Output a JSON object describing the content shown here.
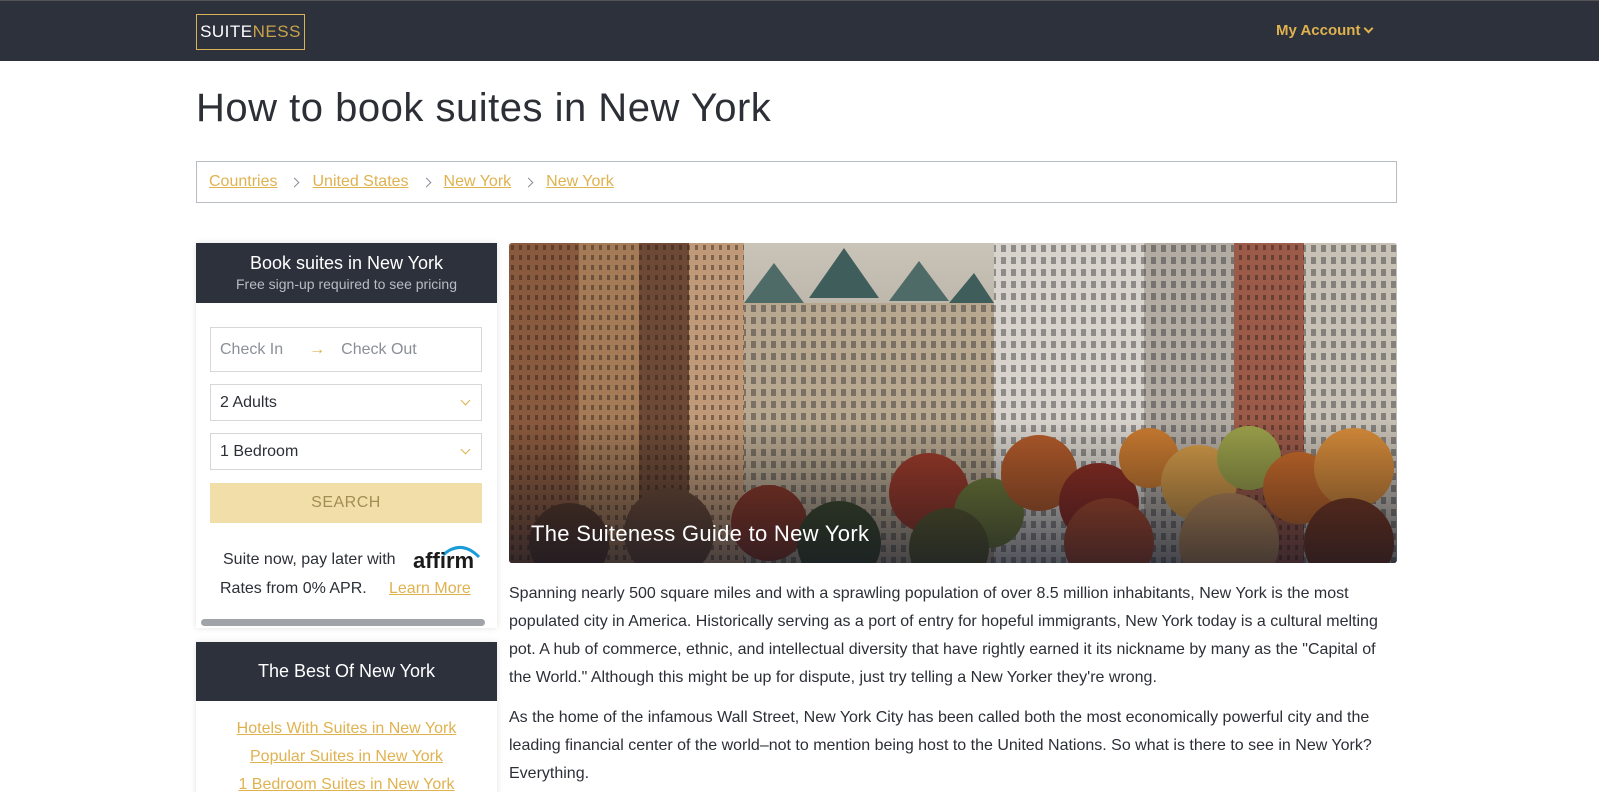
{
  "header": {
    "logo_part1": "SUITE",
    "logo_part2": "NESS",
    "account_label": "My Account"
  },
  "page": {
    "title": "How to book suites in New York"
  },
  "breadcrumb": [
    {
      "label": "Countries"
    },
    {
      "label": "United States"
    },
    {
      "label": "New York"
    },
    {
      "label": "New York"
    }
  ],
  "booking": {
    "heading": "Book suites in New York",
    "subheading": "Free sign-up required to see pricing",
    "check_in_placeholder": "Check In",
    "check_out_placeholder": "Check Out",
    "adults_value": "2 Adults",
    "bedroom_value": "1 Bedroom",
    "search_label": "SEARCH",
    "affirm_line1": "Suite now, pay later with",
    "affirm_logo": "affirm",
    "affirm_line2": "Rates from 0% APR.",
    "learn_more": "Learn More"
  },
  "best_of": {
    "heading": "The Best Of New York",
    "links": [
      "Hotels With Suites in New York",
      "Popular Suites in New York",
      "1 Bedroom Suites in New York"
    ]
  },
  "hero": {
    "caption": "The Suiteness Guide to New York"
  },
  "article": {
    "paragraph1": "Spanning nearly 500 square miles and with a sprawling population of over 8.5 million inhabitants, New York is the most populated city in America. Historically serving as a port of entry for hopeful immigrants, New York today is a cultural melting pot. A hub of commerce, ethnic, and intellectual diversity that have rightly earned it its nickname by many as the \"Capital of the World.\" Although this might be up for dispute, just try telling a New Yorker they're wrong.",
    "paragraph2": "As the home of the infamous Wall Street, New York City has been called both the most economically powerful city and the leading financial center of the world–not to mention being host to the United Nations. So what is there to see in New York? Everything."
  },
  "colors": {
    "navy": "#2c313c",
    "gold": "#e0b24f",
    "search_bg": "#f2dea8"
  }
}
